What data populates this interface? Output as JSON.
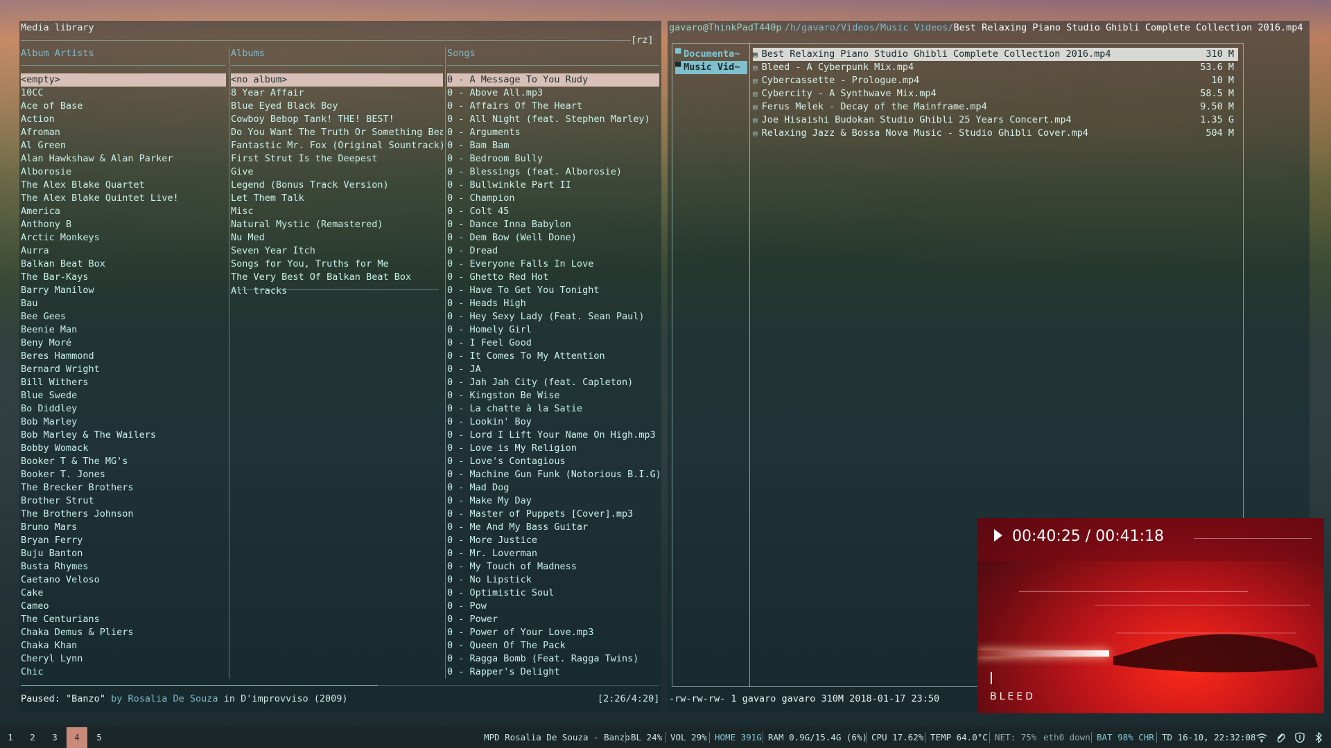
{
  "ncmpcpp": {
    "title": "Media library",
    "tag": "[rz]",
    "columns": {
      "artists_header": "Album Artists",
      "albums_header": "Albums",
      "songs_header": "Songs"
    },
    "artists": [
      "<empty>",
      "10CC",
      "Ace of Base",
      "Action",
      "Afroman",
      "Al Green",
      "Alan Hawkshaw & Alan Parker",
      "Alborosie",
      "The Alex Blake Quartet",
      "The Alex Blake Quintet Live!",
      "America",
      "Anthony B",
      "Arctic Monkeys",
      "Aurra",
      "Balkan Beat Box",
      "The Bar-Kays",
      "Barry Manilow",
      "Bau",
      "Bee Gees",
      "Beenie Man",
      "Beny Moré",
      "Beres Hammond",
      "Bernard Wright",
      "Bill Withers",
      "Blue Swede",
      "Bo Diddley",
      "Bob Marley",
      "Bob Marley & The Wailers",
      "Bobby Womack",
      "Booker T & The MG's",
      "Booker T. Jones",
      "The Brecker Brothers",
      "Brother Strut",
      "The Brothers Johnson",
      "Bruno Mars",
      "Bryan Ferry",
      "Buju Banton",
      "Busta Rhymes",
      "Caetano Veloso",
      "Cake",
      "Cameo",
      "The Centurians",
      "Chaka Demus & Pliers",
      "Chaka Khan",
      "Cheryl Lynn",
      "Chic"
    ],
    "albums": [
      "<no album>",
      "8 Year Affair",
      "Blue Eyed Black Boy",
      "Cowboy Bebop Tank! THE! BEST!",
      "Do You Want The Truth Or Something Bea",
      "Fantastic Mr. Fox (Original Sountrack)",
      "First Strut Is the Deepest",
      "Give",
      "Legend (Bonus Track Version)",
      "Let Them Talk",
      "Misc",
      "Natural Mystic (Remastered)",
      "Nu Med",
      "Seven Year Itch",
      "Songs for You, Truths for Me",
      "The Very Best Of Balkan Beat Box"
    ],
    "all_tracks": "All tracks",
    "songs": [
      "0 - A Message To You Rudy",
      "0 - Above All.mp3",
      "0 - Affairs Of The Heart",
      "0 - All Night (feat. Stephen Marley)",
      "0 - Arguments",
      "0 - Bam Bam",
      "0 - Bedroom Bully",
      "0 - Blessings (feat. Alborosie)",
      "0 - Bullwinkle Part II",
      "0 - Champion",
      "0 - Colt 45",
      "0 - Dance Inna Babylon",
      "0 - Dem Bow (Well Done)",
      "0 - Dread",
      "0 - Everyone Falls In Love",
      "0 - Ghetto Red Hot",
      "0 - Have To Get You Tonight",
      "0 - Heads High",
      "0 - Hey Sexy Lady (Feat. Sean Paul)",
      "0 - Homely Girl",
      "0 - I Feel Good",
      "0 - It Comes To My Attention",
      "0 - JA",
      "0 - Jah Jah City (feat. Capleton)",
      "0 - Kingston Be Wise",
      "0 - La chatte à la Satie",
      "0 - Lookin' Boy",
      "0 - Lord I Lift Your Name On High.mp3",
      "0 - Love is My Religion",
      "0 - Love's Contagious",
      "0 - Machine Gun Funk (Notorious B.I.G)",
      "0 - Mad Dog",
      "0 - Make My Day",
      "0 - Master of Puppets [Cover].mp3",
      "0 - Me And My Bass Guitar",
      "0 - More Justice",
      "0 - Mr. Loverman",
      "0 - My Touch of Madness",
      "0 - No Lipstick",
      "0 - Optimistic Soul",
      "0 - Pow",
      "0 - Power",
      "0 - Power of Your Love.mp3",
      "0 - Queen Of The Pack",
      "0 - Ragga Bomb (Feat. Ragga Twins)",
      "0 - Rapper's Delight"
    ],
    "status": {
      "state": "Paused:",
      "song": "\"Banzo\"",
      "by": "by",
      "artist": "Rosalia De Souza",
      "in": "in",
      "album": "D'improvviso (2009)",
      "time": "[2:26/4:20]"
    }
  },
  "ranger": {
    "user_host": "gavaro@ThinkPadT440p",
    "path": "/h/gavaro/Videos/Music Videos/",
    "current_file": "Best Relaxing Piano Studio Ghibli Complete Collection 2016.mp4",
    "dirs": [
      "Documenta~",
      "Music Vid~"
    ],
    "files": [
      {
        "name": "Best Relaxing Piano Studio Ghibli Complete Collection 2016.mp4",
        "size": "310 M"
      },
      {
        "name": "Bleed - A Cyberpunk Mix.mp4",
        "size": "53.6 M"
      },
      {
        "name": "Cybercassette - Prologue.mp4",
        "size": "10 M"
      },
      {
        "name": "Cybercity - A Synthwave Mix.mp4",
        "size": "58.5 M"
      },
      {
        "name": "Ferus Melek - Decay of the Mainframe.mp4",
        "size": "9.50 M"
      },
      {
        "name": "Joe Hisaishi Budokan Studio Ghibli 25 Years Concert.mp4",
        "size": "1.35 G"
      },
      {
        "name": "Relaxing Jazz & Bossa Nova Music - Studio Ghibli Cover.mp4",
        "size": "504 M"
      }
    ],
    "file_icon": "▤",
    "dir_icon": "▀",
    "statusline": "-rw-rw-rw- 1 gavaro gavaro 310M 2018-01-17 23:50"
  },
  "player": {
    "time": "00:40:25 / 00:41:18",
    "title": "BLEED",
    "cursor_glyph": "I",
    "play_icon": "play-icon"
  },
  "taskbar": {
    "workspaces": [
      "1",
      "2",
      "3",
      "4",
      "5"
    ],
    "active_workspace": "4",
    "mpd": "MPD Rosalia De Souza - Banzo",
    "bl": "BL 24%",
    "vol": "VOL 29%",
    "home": "HOME 391G",
    "ram": "RAM 0.9G/15.4G (6%)",
    "cpu": "CPU 17.62%",
    "temp": "TEMP 64.0°C",
    "net": "NET: 75%",
    "eth": "eth0 down",
    "bat": "BAT 98% CHR",
    "date": "TD 16-10, 22:32:08",
    "tray_icons": [
      "wifi-icon",
      "paperclip-icon",
      "shield-icon",
      "bluetooth-icon"
    ]
  }
}
